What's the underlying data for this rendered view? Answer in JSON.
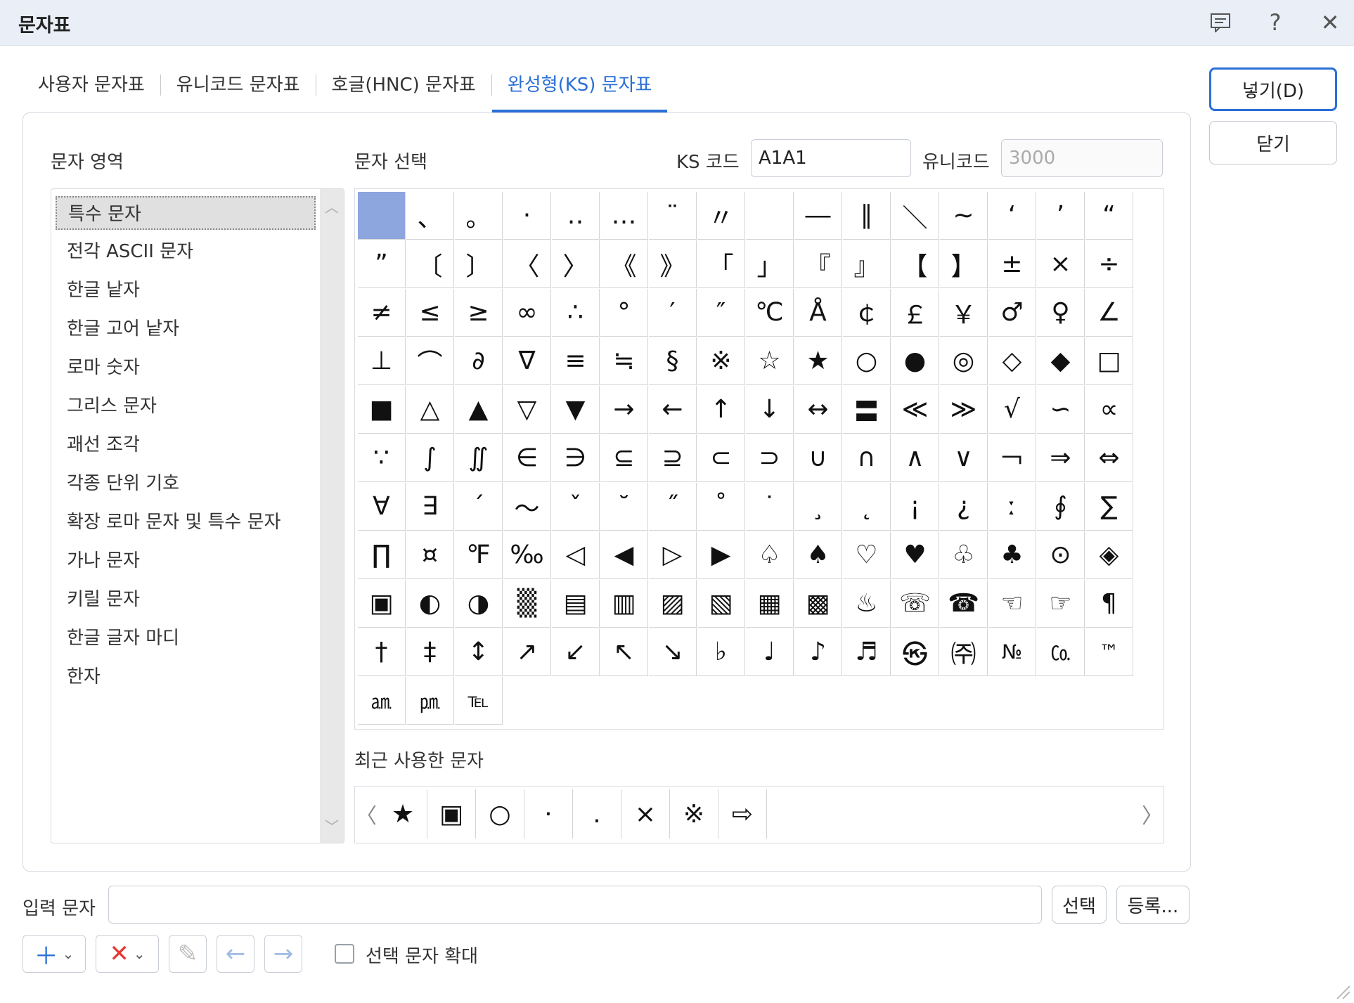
{
  "window": {
    "title": "문자표",
    "icons": [
      "comment-icon",
      "help-icon",
      "close-icon"
    ]
  },
  "tabs": [
    {
      "label": "사용자 문자표",
      "active": false
    },
    {
      "label": "유니코드 문자표",
      "active": false
    },
    {
      "label": "호글(HNC) 문자표",
      "active": false
    },
    {
      "label": "완성형(KS) 문자표",
      "active": true
    }
  ],
  "region": {
    "label": "문자 영역",
    "items": [
      "특수 문자",
      "전각 ASCII 문자",
      "한글 낱자",
      "한글 고어 낱자",
      "로마 숫자",
      "그리스 문자",
      "괘선 조각",
      "각종 단위 기호",
      "확장 로마 문자 및 특수 문자",
      "가나 문자",
      "키릴 문자",
      "한글 글자 마디",
      "한자"
    ],
    "selected": "특수 문자"
  },
  "selection": {
    "label": "문자 선택",
    "ks_label": "KS 코드",
    "ks_value": "A1A1",
    "unicode_label": "유니코드",
    "unicode_value": "3000"
  },
  "chars": [
    " ",
    "、",
    "。",
    "·",
    "‥",
    "…",
    "¨",
    "〃",
    "­",
    "―",
    "∥",
    "＼",
    "∼",
    "‘",
    "’",
    "“",
    "”",
    "〔",
    "〕",
    "〈",
    "〉",
    "《",
    "》",
    "「",
    "」",
    "『",
    "』",
    "【",
    "】",
    "±",
    "×",
    "÷",
    "≠",
    "≤",
    "≥",
    "∞",
    "∴",
    "°",
    "′",
    "″",
    "℃",
    "Å",
    "￠",
    "￡",
    "￥",
    "♂",
    "♀",
    "∠",
    "⊥",
    "⌒",
    "∂",
    "∇",
    "≡",
    "≒",
    "§",
    "※",
    "☆",
    "★",
    "○",
    "●",
    "◎",
    "◇",
    "◆",
    "□",
    "■",
    "△",
    "▲",
    "▽",
    "▼",
    "→",
    "←",
    "↑",
    "↓",
    "↔",
    "〓",
    "≪",
    "≫",
    "√",
    "∽",
    "∝",
    "∵",
    "∫",
    "∬",
    "∈",
    "∋",
    "⊆",
    "⊇",
    "⊂",
    "⊃",
    "∪",
    "∩",
    "∧",
    "∨",
    "￢",
    "⇒",
    "⇔",
    "∀",
    "∃",
    "´",
    "～",
    "ˇ",
    "˘",
    "˝",
    "˚",
    "˙",
    "¸",
    "˛",
    "¡",
    "¿",
    "ː",
    "∮",
    "∑",
    "∏",
    "¤",
    "℉",
    "‰",
    "◁",
    "◀",
    "▷",
    "▶",
    "♤",
    "♠",
    "♡",
    "♥",
    "♧",
    "♣",
    "⊙",
    "◈",
    "▣",
    "◐",
    "◑",
    "▒",
    "▤",
    "▥",
    "▨",
    "▧",
    "▦",
    "▩",
    "♨",
    "☏",
    "☎",
    "☜",
    "☞",
    "¶",
    "†",
    "‡",
    "↕",
    "↗",
    "↙",
    "↖",
    "↘",
    "♭",
    "♩",
    "♪",
    "♬",
    "㉿",
    "㈜",
    "№",
    "㏇",
    "™",
    "㏂",
    "㏘",
    "℡"
  ],
  "recent": {
    "label": "최근 사용한 문자",
    "chars": [
      "★",
      "▣",
      "○",
      "·",
      ".",
      "×",
      "※",
      "⇨"
    ],
    "prev": "〈",
    "next": "〉"
  },
  "buttons": {
    "insert": "넣기(D)",
    "close": "닫기",
    "select": "선택",
    "register": "등록..."
  },
  "input": {
    "label": "입력 문자",
    "value": ""
  },
  "toolbar": {
    "enlarge_label": "선택 문자 확대",
    "enlarge_checked": false
  },
  "colors": {
    "accent": "#2a6fd6",
    "selected_cell": "#8ea6de",
    "titlebar": "#e9eef7",
    "remove": "#e53935"
  }
}
